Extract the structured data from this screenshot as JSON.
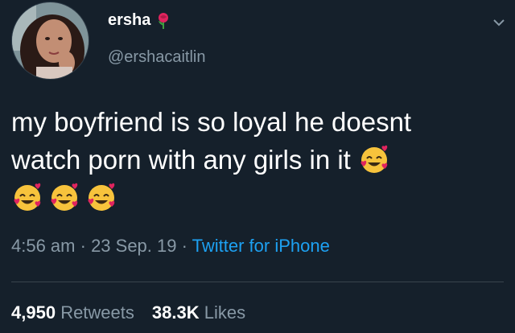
{
  "tweet": {
    "display_name": "ersha",
    "handle": "@ershacaitlin",
    "text_line1": "my boyfriend is so loyal he doesnt",
    "text_line2": "watch porn with any girls in it",
    "emoji_name": "smiling-face-with-hearts",
    "time": "4:56 am",
    "separator": " · ",
    "date": "23 Sep. 19",
    "source": "Twitter for iPhone",
    "retweets_count": "4,950",
    "retweets_label": "Retweets",
    "likes_count": "38.3K",
    "likes_label": "Likes"
  },
  "colors": {
    "background": "#15202b",
    "text_primary": "#ffffff",
    "text_secondary": "#8899a6",
    "link": "#1da1f2",
    "divider": "#38444d"
  },
  "icons": [
    "rose-icon",
    "chevron-down-icon",
    "smiling-face-with-hearts-emoji"
  ]
}
